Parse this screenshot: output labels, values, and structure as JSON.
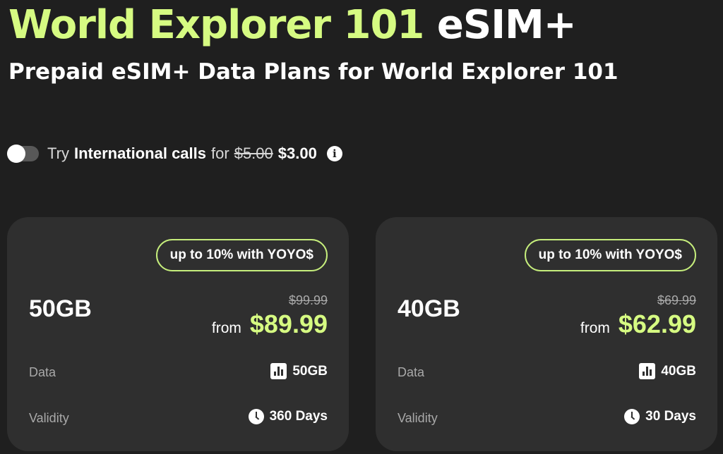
{
  "header": {
    "title_accent": "World Explorer 101",
    "title_suffix": "eSIM+",
    "subtitle": "Prepaid eSIM+ Data Plans for World Explorer 101"
  },
  "calls_offer": {
    "prefix": "Try",
    "service": "International calls",
    "connector": "for",
    "old_price": "$5.00",
    "new_price": "$3.00",
    "toggle_on": false,
    "info_glyph": "i"
  },
  "plans": [
    {
      "badge": "up to 10% with YOYO$",
      "size": "50GB",
      "old_price": "$99.99",
      "from_label": "from",
      "price": "$89.99",
      "data_label": "Data",
      "data_value": "50GB",
      "validity_label": "Validity",
      "validity_value": "360 Days"
    },
    {
      "badge": "up to 10% with YOYO$",
      "size": "40GB",
      "old_price": "$69.99",
      "from_label": "from",
      "price": "$62.99",
      "data_label": "Data",
      "data_value": "40GB",
      "validity_label": "Validity",
      "validity_value": "30 Days"
    }
  ],
  "colors": {
    "background": "#1f1f1f",
    "card": "#2f2f2f",
    "accent": "#d6fb82"
  },
  "icons": {
    "data": "bar-chart-icon",
    "validity": "clock-icon",
    "info": "info-icon"
  }
}
